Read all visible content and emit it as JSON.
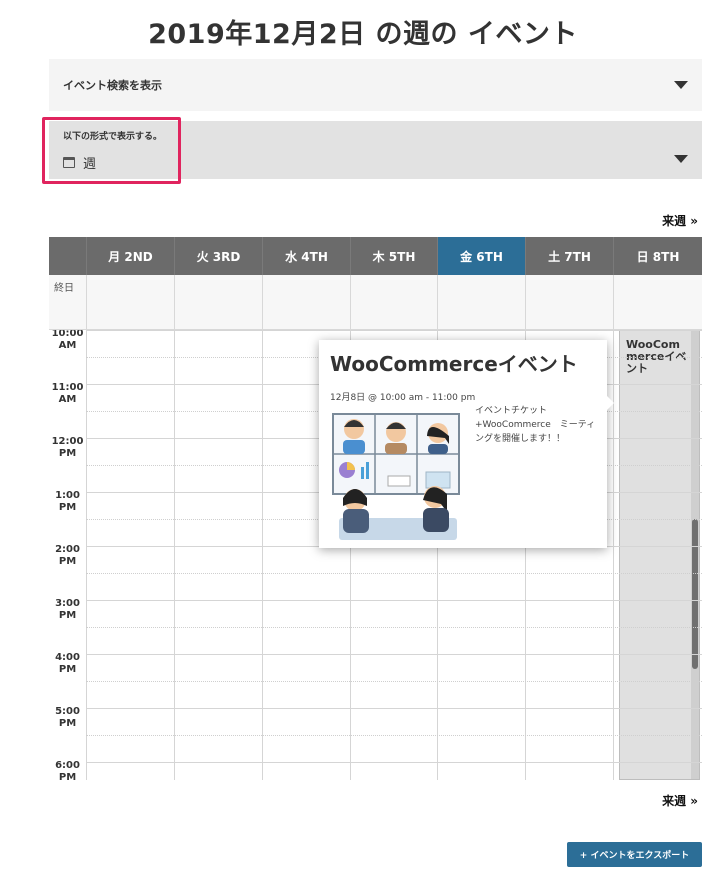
{
  "page": {
    "title": "2019年12月2日 の週の イベント"
  },
  "search": {
    "label": "イベント検索を表示"
  },
  "view_selector": {
    "caption": "以下の形式で表示する。",
    "current": "週"
  },
  "nav": {
    "next_week": "来週 »"
  },
  "calendar": {
    "days": [
      {
        "label": "月 2ND",
        "today": false
      },
      {
        "label": "火 3RD",
        "today": false
      },
      {
        "label": "水 4TH",
        "today": false
      },
      {
        "label": "木 5TH",
        "today": false
      },
      {
        "label": "金 6TH",
        "today": true
      },
      {
        "label": "土 7TH",
        "today": false
      },
      {
        "label": "日 8TH",
        "today": false
      }
    ],
    "allday_label": "終日",
    "hours": [
      [
        "10:00",
        "AM"
      ],
      [
        "11:00",
        "AM"
      ],
      [
        "12:00",
        "PM"
      ],
      [
        "1:00",
        "PM"
      ],
      [
        "2:00",
        "PM"
      ],
      [
        "3:00",
        "PM"
      ],
      [
        "4:00",
        "PM"
      ],
      [
        "5:00",
        "PM"
      ],
      [
        "6:00",
        "PM"
      ]
    ],
    "event_block_title": "WooCommerceイベント"
  },
  "tooltip": {
    "title": "WooCommerceイベント",
    "date": "12月8日 @ 10:00 am - 11:00 pm",
    "description": "イベントチケット+WooCommerce　ミーティングを開催します！！"
  },
  "export_button": "+ イベントをエクスポート",
  "colors": {
    "accent": "#2c6e97",
    "highlight": "#e0245e",
    "header_bg": "#6b6b6b"
  },
  "icons": [
    "dropdown-caret-icon",
    "calendar-icon"
  ]
}
